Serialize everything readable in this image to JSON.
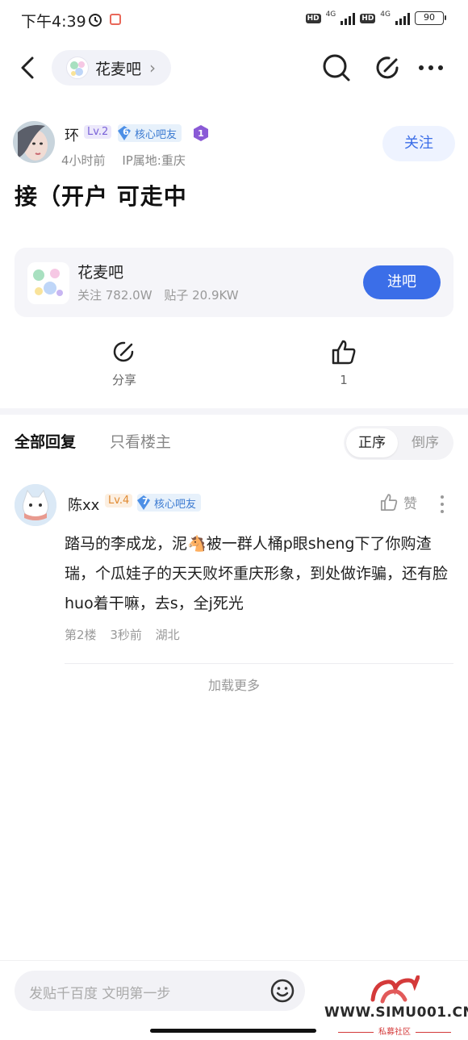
{
  "status_bar": {
    "time": "下午4:39",
    "network_label": "4G",
    "battery_level": "90"
  },
  "topbar": {
    "forum_name": "花麦吧",
    "chevron": "›"
  },
  "post": {
    "author": "环",
    "level": "Lv.2",
    "core_badge_level": "6",
    "core_badge_label": "核心吧友",
    "medal_number": "1",
    "time_ago": "4小时前",
    "ip_location": "IP属地:重庆",
    "follow_label": "关注",
    "title": "接（开户 可走中"
  },
  "forum_card": {
    "name": "花麦吧",
    "followers": "关注 782.0W",
    "posts": "贴子 20.9KW",
    "enter_label": "进吧"
  },
  "actions": {
    "share_label": "分享",
    "like_count": "1"
  },
  "tabs": {
    "all_replies": "全部回复",
    "op_only": "只看楼主",
    "sort_asc": "正序",
    "sort_desc": "倒序"
  },
  "reply": {
    "author": "陈xx",
    "level": "Lv.4",
    "core_badge_level": "7",
    "core_badge_label": "核心吧友",
    "like_label": "赞",
    "body_part1": "踏马的李成龙，泥",
    "body_emoji": "🐴",
    "body_part2": "被一群人桶p眼sheng下了你购渣瑞，个瓜娃子的天天败坏重庆形象，到处做诈骗，还有脸huo着干嘛，去s，全j死光",
    "floor": "第2楼",
    "time_ago": "3秒前",
    "location": "湖北"
  },
  "load_more_label": "加载更多",
  "bottom_bar": {
    "compose_placeholder": "发贴千百度 文明第一步"
  },
  "watermark": {
    "site": "WWW.SIMU001.CN",
    "label": "私募社区"
  },
  "colors": {
    "accent_blue": "#3b6ee8",
    "level_purple": "#7a63d8",
    "level_orange": "#e08a32",
    "badge_blue": "#3b7ad1",
    "watermark_red": "#d43a3a"
  }
}
